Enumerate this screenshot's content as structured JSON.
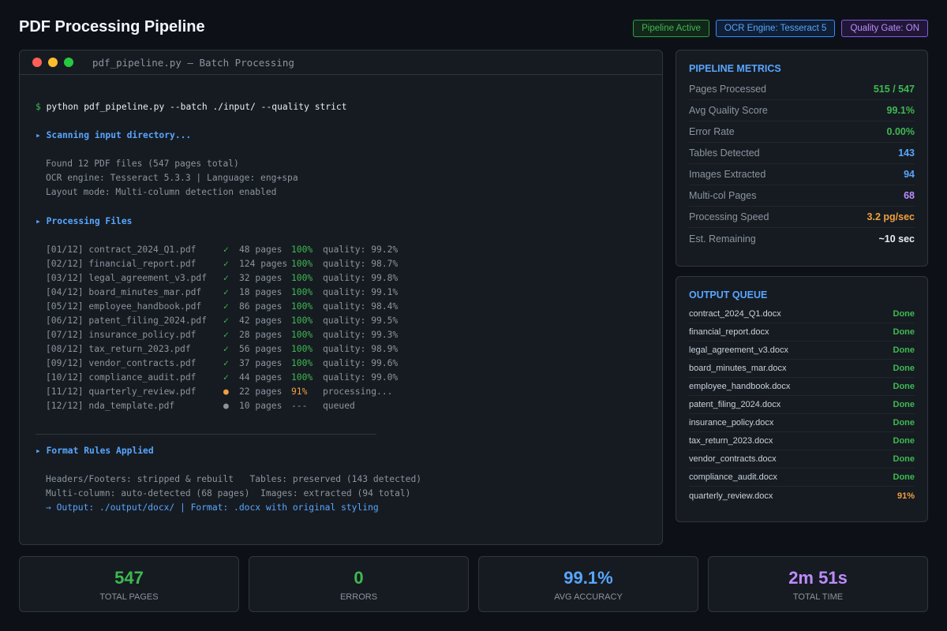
{
  "header": {
    "title": "PDF Processing Pipeline",
    "badges": [
      "Pipeline Active",
      "OCR Engine: Tesseract 5",
      "Quality Gate: ON"
    ]
  },
  "terminal": {
    "title": "pdf_pipeline.py — Batch Processing",
    "prompt": "$",
    "command": "python pdf_pipeline.py --batch ./input/ --quality strict",
    "scan_section": "▸ Scanning input directory...",
    "scan_lines": [
      "Found 12 PDF files (547 pages total)",
      "OCR engine: Tesseract 5.3.3 | Language: eng+spa",
      "Layout mode: Multi-column detection enabled"
    ],
    "process_section": "▸ Processing Files",
    "files": [
      {
        "id": "[01/12] contract_2024_Q1.pdf",
        "status": "✓",
        "pages": "48 pages",
        "pct": "100%",
        "info": "quality: 99.2%"
      },
      {
        "id": "[02/12] financial_report.pdf",
        "status": "✓",
        "pages": "124 pages",
        "pct": "100%",
        "info": "quality: 98.7%"
      },
      {
        "id": "[03/12] legal_agreement_v3.pdf",
        "status": "✓",
        "pages": "32 pages",
        "pct": "100%",
        "info": "quality: 99.8%"
      },
      {
        "id": "[04/12] board_minutes_mar.pdf",
        "status": "✓",
        "pages": "18 pages",
        "pct": "100%",
        "info": "quality: 99.1%"
      },
      {
        "id": "[05/12] employee_handbook.pdf",
        "status": "✓",
        "pages": "86 pages",
        "pct": "100%",
        "info": "quality: 98.4%"
      },
      {
        "id": "[06/12] patent_filing_2024.pdf",
        "status": "✓",
        "pages": "42 pages",
        "pct": "100%",
        "info": "quality: 99.5%"
      },
      {
        "id": "[07/12] insurance_policy.pdf",
        "status": "✓",
        "pages": "28 pages",
        "pct": "100%",
        "info": "quality: 99.3%"
      },
      {
        "id": "[08/12] tax_return_2023.pdf",
        "status": "✓",
        "pages": "56 pages",
        "pct": "100%",
        "info": "quality: 98.9%"
      },
      {
        "id": "[09/12] vendor_contracts.pdf",
        "status": "✓",
        "pages": "37 pages",
        "pct": "100%",
        "info": "quality: 99.6%"
      },
      {
        "id": "[10/12] compliance_audit.pdf",
        "status": "✓",
        "pages": "44 pages",
        "pct": "100%",
        "info": "quality: 99.0%"
      },
      {
        "id": "[11/12] quarterly_review.pdf",
        "status": "●",
        "pages": "22 pages",
        "pct": "91%",
        "info": "processing..."
      },
      {
        "id": "[12/12] nda_template.pdf",
        "status": "●",
        "pages": "10 pages",
        "pct": "---",
        "info": "queued"
      }
    ],
    "rules_section": "▸ Format Rules Applied",
    "rules_lines": [
      "Headers/Footers: stripped & rebuilt   Tables: preserved (143 detected)",
      "Multi-column: auto-detected (68 pages)  Images: extracted (94 total)"
    ],
    "output_line": "→ Output: ./output/docx/ | Format: .docx with original styling"
  },
  "metrics": {
    "title": "PIPELINE METRICS",
    "items": [
      {
        "label": "Pages Processed",
        "value": "515 / 547",
        "color": "#3fb950"
      },
      {
        "label": "Avg Quality Score",
        "value": "99.1%",
        "color": "#3fb950"
      },
      {
        "label": "Error Rate",
        "value": "0.00%",
        "color": "#3fb950"
      },
      {
        "label": "Tables Detected",
        "value": "143",
        "color": "#58a6ff"
      },
      {
        "label": "Images Extracted",
        "value": "94",
        "color": "#58a6ff"
      },
      {
        "label": "Multi-col Pages",
        "value": "68",
        "color": "#bc8cff"
      },
      {
        "label": "Processing Speed",
        "value": "3.2 pg/sec",
        "color": "#f0a03c"
      },
      {
        "label": "Est. Remaining",
        "value": "~10 sec",
        "color": "#e6edf3"
      }
    ]
  },
  "queue": {
    "title": "OUTPUT QUEUE",
    "items": [
      {
        "name": "contract_2024_Q1.docx",
        "status": "Done",
        "color": "#3fb950"
      },
      {
        "name": "financial_report.docx",
        "status": "Done",
        "color": "#3fb950"
      },
      {
        "name": "legal_agreement_v3.docx",
        "status": "Done",
        "color": "#3fb950"
      },
      {
        "name": "board_minutes_mar.docx",
        "status": "Done",
        "color": "#3fb950"
      },
      {
        "name": "employee_handbook.docx",
        "status": "Done",
        "color": "#3fb950"
      },
      {
        "name": "patent_filing_2024.docx",
        "status": "Done",
        "color": "#3fb950"
      },
      {
        "name": "insurance_policy.docx",
        "status": "Done",
        "color": "#3fb950"
      },
      {
        "name": "tax_return_2023.docx",
        "status": "Done",
        "color": "#3fb950"
      },
      {
        "name": "vendor_contracts.docx",
        "status": "Done",
        "color": "#3fb950"
      },
      {
        "name": "compliance_audit.docx",
        "status": "Done",
        "color": "#3fb950"
      },
      {
        "name": "quarterly_review.docx",
        "status": "91%",
        "color": "#f0a03c"
      }
    ]
  },
  "stats": [
    {
      "value": "547",
      "label": "TOTAL PAGES",
      "color": "#3fb950"
    },
    {
      "value": "0",
      "label": "ERRORS",
      "color": "#3fb950"
    },
    {
      "value": "99.1%",
      "label": "AVG ACCURACY",
      "color": "#58a6ff"
    },
    {
      "value": "2m 51s",
      "label": "TOTAL TIME",
      "color": "#bc8cff"
    }
  ]
}
